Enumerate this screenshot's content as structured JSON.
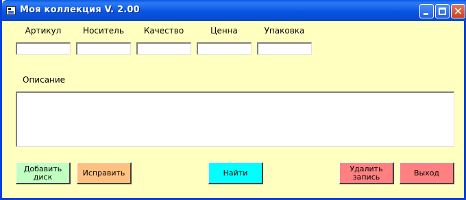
{
  "window": {
    "title": "Моя коллекция V. 2.00",
    "icon": "app-icon"
  },
  "title_buttons": {
    "minimize_icon": "minimize-icon",
    "maximize_icon": "maximize-icon",
    "close_icon": "close-icon",
    "close_glyph": "✕"
  },
  "fields": [
    {
      "label": "Артикул",
      "value": ""
    },
    {
      "label": "Носитель",
      "value": ""
    },
    {
      "label": "Качество",
      "value": ""
    },
    {
      "label": "Ценна",
      "value": ""
    },
    {
      "label": "Упаковка",
      "value": ""
    }
  ],
  "description": {
    "label": "Описание",
    "value": ""
  },
  "buttons": {
    "add": "Добавить диск",
    "edit": "Исправить",
    "find": "Найти",
    "delete": "Удалить запись",
    "exit": "Выход"
  },
  "colors": {
    "form_background": "#FFFFC0",
    "add_button": "#C0FFC0",
    "edit_button": "#FFC080",
    "find_button": "#00FFFF",
    "delete_button": "#FF8080",
    "exit_button": "#FF8080",
    "title_bar": "#0754E3"
  }
}
